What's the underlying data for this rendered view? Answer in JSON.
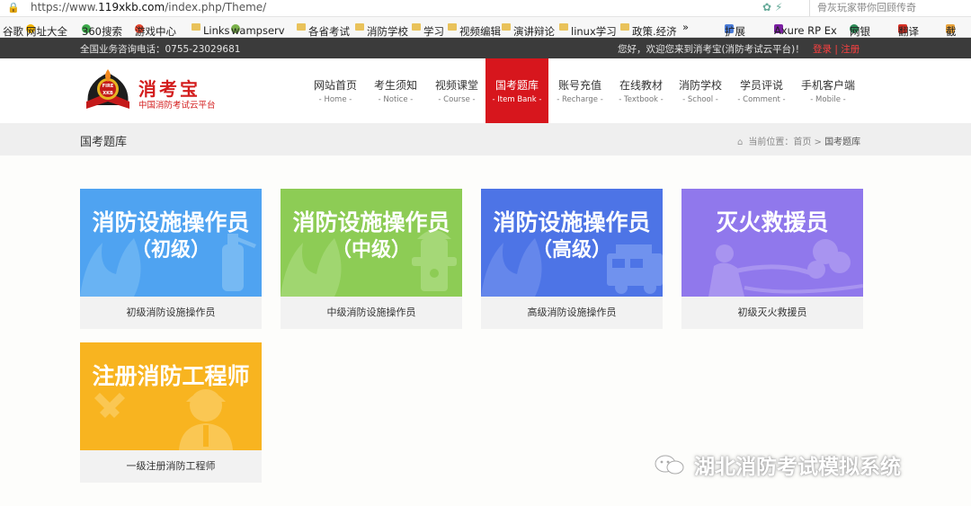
{
  "browser": {
    "url_prefix": "https://www.",
    "url_domain": "119xkb.com",
    "url_path": "/index.php/Theme/",
    "search_hint": "骨灰玩家带你回顾传奇",
    "bookmarks": [
      "谷歌",
      "网址大全",
      "360搜索",
      "游戏中心",
      "Links",
      "wampserv",
      "各省考试",
      "消防学校",
      "学习",
      "视频编辑",
      "演讲辩论",
      "linux学习",
      "»",
      "政策.经济",
      "扩展",
      "Axure RP Ex",
      "网银",
      "翻译",
      "截"
    ]
  },
  "topbar": {
    "hotline": "全国业务咨询电话：0755-23029681",
    "welcome": "您好，欢迎您来到消考宝(消防考试云平台)！",
    "auth": "登录 | 注册"
  },
  "site": {
    "brand": "消考宝",
    "brand_sub": "中国消防考试云平台",
    "logo_top": "FIRE",
    "logo_bottom": "XKB"
  },
  "nav": [
    {
      "cn": "网站首页",
      "en": "- Home -"
    },
    {
      "cn": "考生须知",
      "en": "- Notice -"
    },
    {
      "cn": "视频课堂",
      "en": "- Course -"
    },
    {
      "cn": "国考题库",
      "en": "- Item Bank -"
    },
    {
      "cn": "账号充值",
      "en": "- Recharge -"
    },
    {
      "cn": "在线教材",
      "en": "- Textbook -"
    },
    {
      "cn": "消防学校",
      "en": "- School -"
    },
    {
      "cn": "学员评说",
      "en": "- Comment -"
    },
    {
      "cn": "手机客户端",
      "en": "- Mobile -"
    }
  ],
  "page": {
    "title": "国考题库",
    "crumb_label": "当前位置：",
    "crumb_home": "首页",
    "crumb_sep": " > ",
    "crumb_current": "国考题库"
  },
  "cards": [
    {
      "line1": "消防设施操作员",
      "line2": "（初级）",
      "caption": "初级消防设施操作员",
      "color": "#4fa3f1"
    },
    {
      "line1": "消防设施操作员",
      "line2": "（中级）",
      "caption": "中级消防设施操作员",
      "color": "#8dcc55"
    },
    {
      "line1": "消防设施操作员",
      "line2": "（高级）",
      "caption": "高级消防设施操作员",
      "color": "#4d74e6"
    },
    {
      "line1": "灭火救援员",
      "line2": "",
      "caption": "初级灭火救援员",
      "color": "#9078ec"
    },
    {
      "line1": "注册消防工程师",
      "line2": "",
      "caption": "一级注册消防工程师",
      "color": "#f8b420"
    }
  ],
  "watermark": "湖北消防考试模拟系统",
  "colors": {
    "accent": "#d7161d",
    "topbar": "#3b3b3b"
  }
}
